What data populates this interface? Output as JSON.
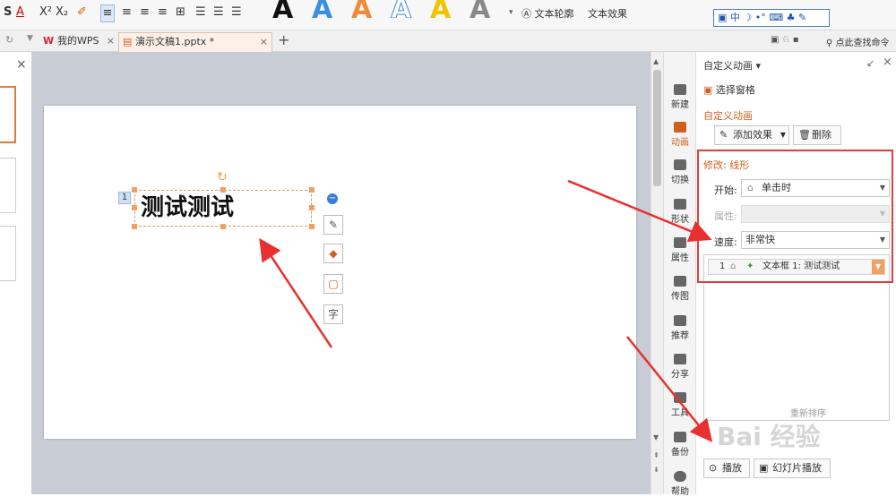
{
  "ribbon": {
    "font_tools": [
      "S",
      "A",
      "X²",
      "X₂"
    ],
    "wordart_letters": [
      "A",
      "A",
      "A",
      "A",
      "A",
      "A"
    ],
    "wordart_colors": [
      "#111111",
      "#3a8fe0",
      "#f08a3c",
      "#3a8fe0",
      "#f2c400",
      "#888888"
    ],
    "text_outline": "文本轮廓",
    "text_effect": "文本效果",
    "ime_label": "中"
  },
  "tabs": {
    "my_wps": "我的WPS",
    "doc": "演示文稿1.pptx *",
    "new_tab": "+",
    "search": "点此查找命令"
  },
  "slide": {
    "title_text": "测试测试",
    "anim_number": "1"
  },
  "float_tools": [
    "✎",
    "◆",
    "▢",
    "字"
  ],
  "side_icons": [
    "新建",
    "动画",
    "切换",
    "形状",
    "属性",
    "传图",
    "推荐",
    "分享",
    "工具",
    "备份",
    "帮助"
  ],
  "pane": {
    "header": "自定义动画",
    "select_pane": "选择窗格",
    "section_title": "自定义动画",
    "add_effect": "添加效果",
    "delete": "删除",
    "modify_title": "修改: 线形",
    "start_label": "开始:",
    "start_value": "单击时",
    "property_label": "属性:",
    "property_value": "",
    "speed_label": "速度:",
    "speed_value": "非常快",
    "anim_item_index": "1",
    "anim_item_label": "文本框 1: 测试测试",
    "play": "播放",
    "slideshow": "幻灯片播放",
    "reorder": "重新排序"
  },
  "watermark": "Bai 经验"
}
